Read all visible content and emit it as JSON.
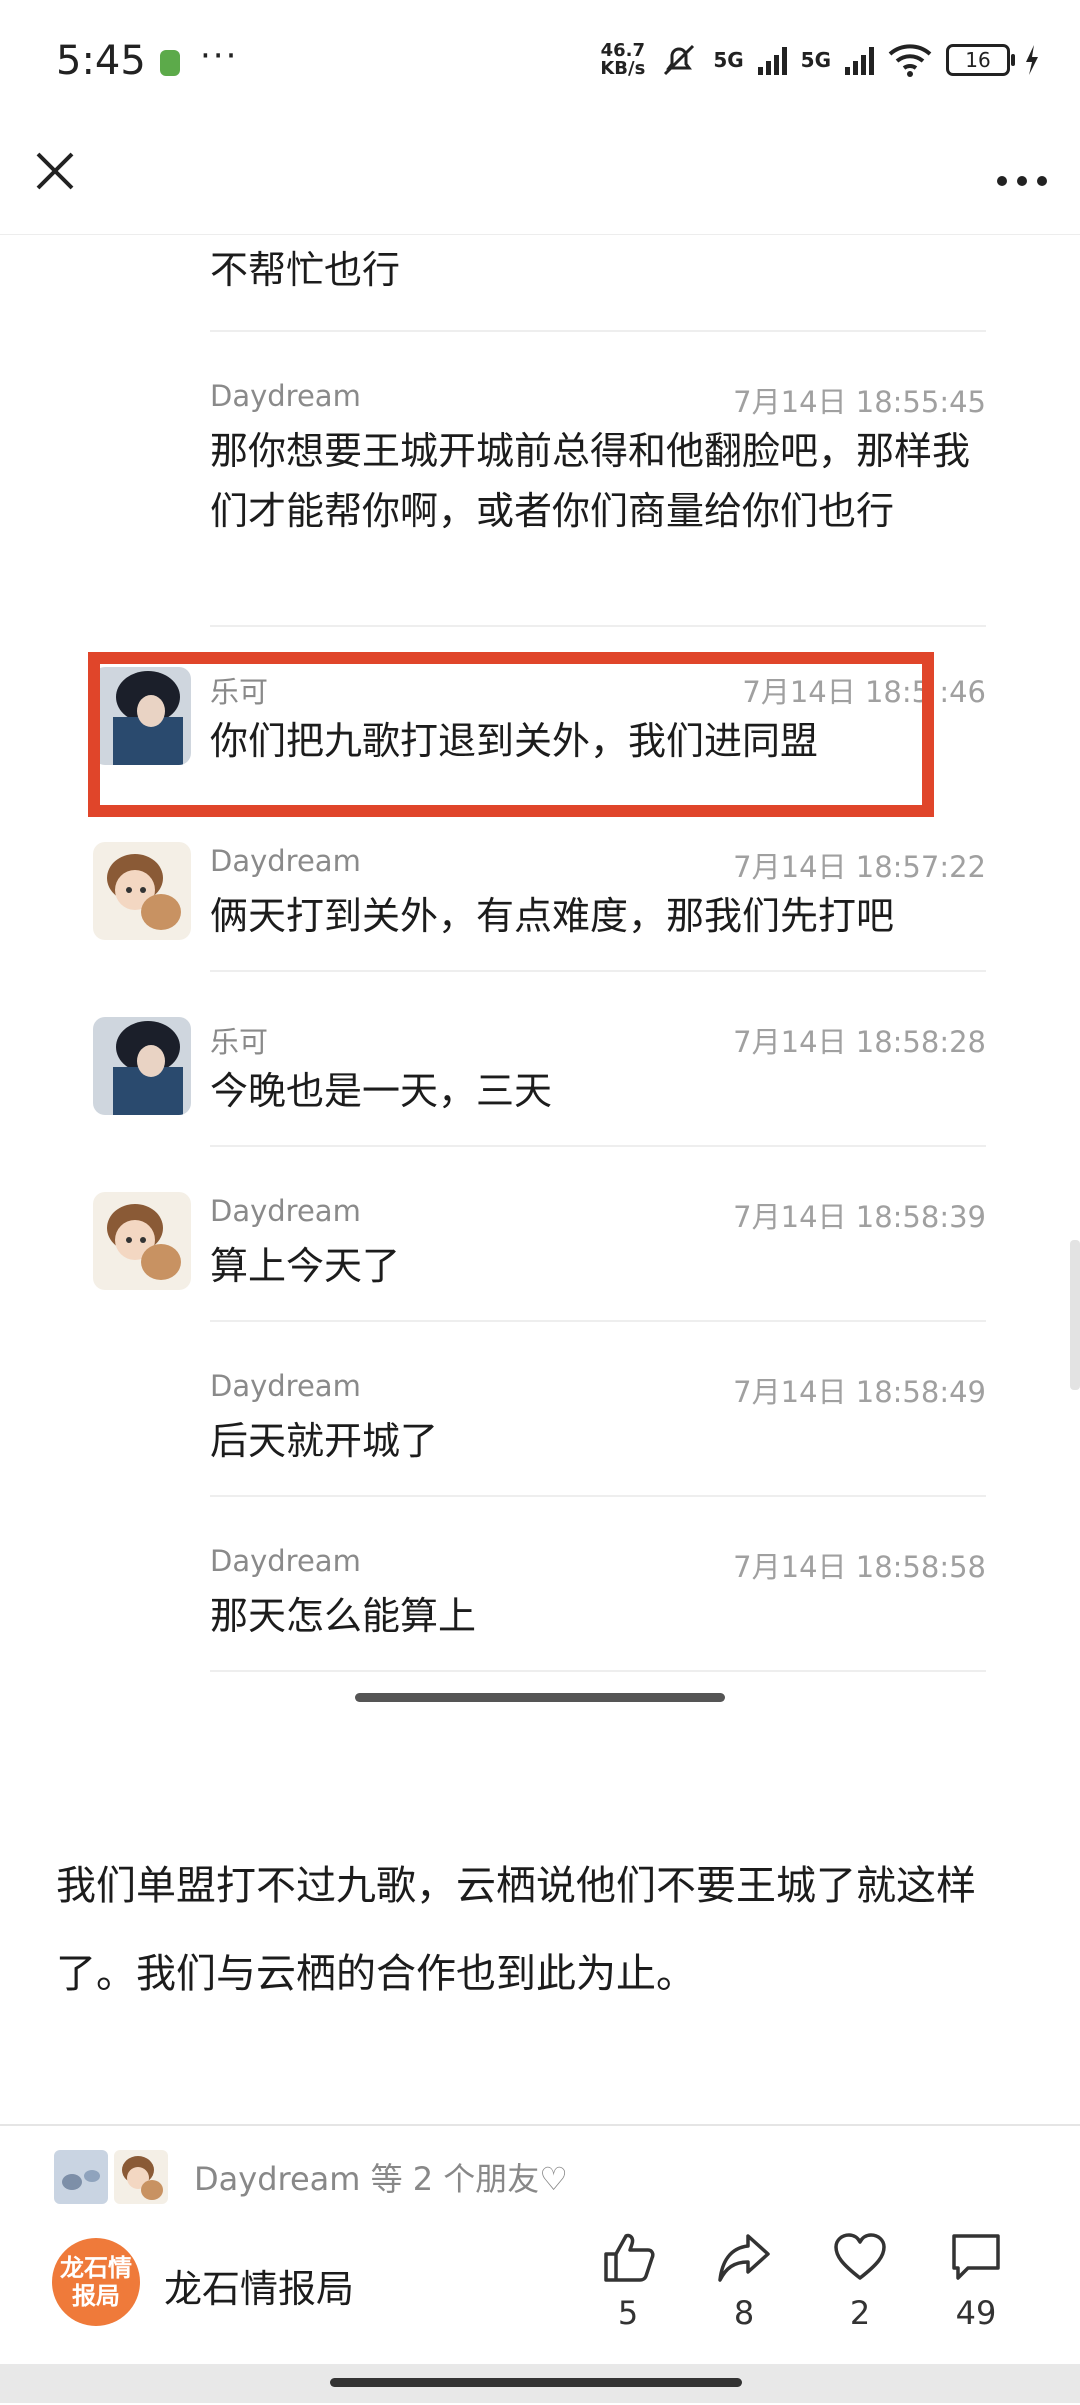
{
  "status_bar": {
    "time": "5:45",
    "more": "···",
    "speed_top": "46.7",
    "speed_bottom": "KB/s",
    "signal1": "5G",
    "signal2": "5G",
    "battery": "16"
  },
  "nav": {
    "close_icon": "close-icon",
    "more_icon": "more-icon"
  },
  "messages": [
    {
      "name": "",
      "time": "",
      "text": "不帮忙也行",
      "avatar": ""
    },
    {
      "name": "Daydream",
      "time": "7月14日 18:55:45",
      "text": "那你想要王城开城前总得和他翻脸吧，那样我们才能帮你啊，或者你们商量给你们也行",
      "avatar": ""
    },
    {
      "name": "乐可",
      "time": "7月14日 18:5 :46",
      "text": "你们把九歌打退到关外，我们进同盟",
      "avatar": "dark-hair-avatar"
    },
    {
      "name": "Daydream",
      "time": "7月14日 18:57:22",
      "text": "俩天打到关外，有点难度，那我们先打吧",
      "avatar": "puppy-avatar"
    },
    {
      "name": "乐可",
      "time": "7月14日 18:58:28",
      "text": "今晚也是一天，三天",
      "avatar": "dark-hair-avatar"
    },
    {
      "name": "Daydream",
      "time": "7月14日 18:58:39",
      "text": "算上今天了",
      "avatar": "puppy-avatar"
    },
    {
      "name": "Daydream",
      "time": "7月14日 18:58:49",
      "text": "后天就开城了",
      "avatar": ""
    },
    {
      "name": "Daydream",
      "time": "7月14日 18:58:58",
      "text": "那天怎么能算上",
      "avatar": ""
    }
  ],
  "article": {
    "paragraph": "我们单盟打不过九歌，云栖说他们不要王城了就这样了。我们与云栖的合作也到此为止。"
  },
  "footer": {
    "likers_text": "Daydream 等 2 个朋友♡",
    "account_name": "龙石情报局",
    "logo_text": "龙石情报局",
    "actions": [
      {
        "icon": "thumbs-up-icon",
        "count": "5"
      },
      {
        "icon": "share-icon",
        "count": "8"
      },
      {
        "icon": "heart-icon",
        "count": "2"
      },
      {
        "icon": "comment-icon",
        "count": "49"
      }
    ]
  },
  "colors": {
    "highlight": "#e0452a",
    "logo": "#ef7a3a"
  }
}
